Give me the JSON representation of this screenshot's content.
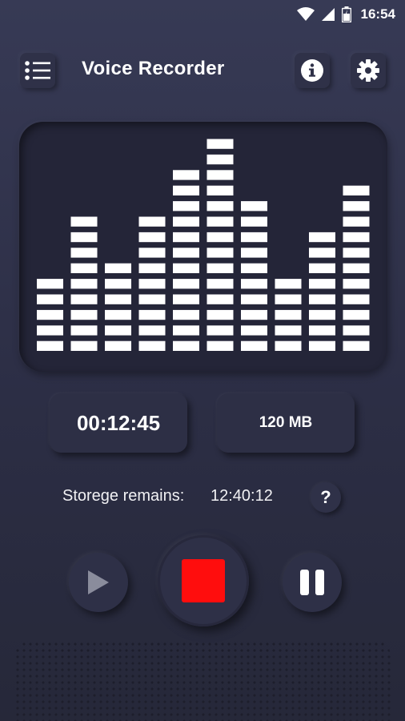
{
  "status_bar": {
    "time": "16:54",
    "icons": [
      "wifi-icon",
      "signal-icon",
      "battery-icon"
    ]
  },
  "header": {
    "title": "Voice Recorder",
    "menu_icon": "list-menu-icon",
    "info_icon": "info-icon",
    "settings_icon": "gear-icon"
  },
  "visualizer": {
    "max_segments": 14,
    "bar_levels": [
      5,
      9,
      6,
      9,
      12,
      14,
      10,
      5,
      8,
      11
    ],
    "segment_color": "#ffffff"
  },
  "stats": {
    "elapsed_time": "00:12:45",
    "file_size": "120 MB",
    "storage_label": "Storege remains:",
    "storage_value": "12:40:12",
    "help_label": "?"
  },
  "controls": {
    "play_icon": "play-icon",
    "stop_icon": "stop-icon",
    "pause_icon": "pause-icon",
    "stop_color": "#ff0d0d"
  },
  "colors": {
    "background": "#2f3148",
    "panel": "#242538",
    "accent": "#ff0d0d"
  }
}
